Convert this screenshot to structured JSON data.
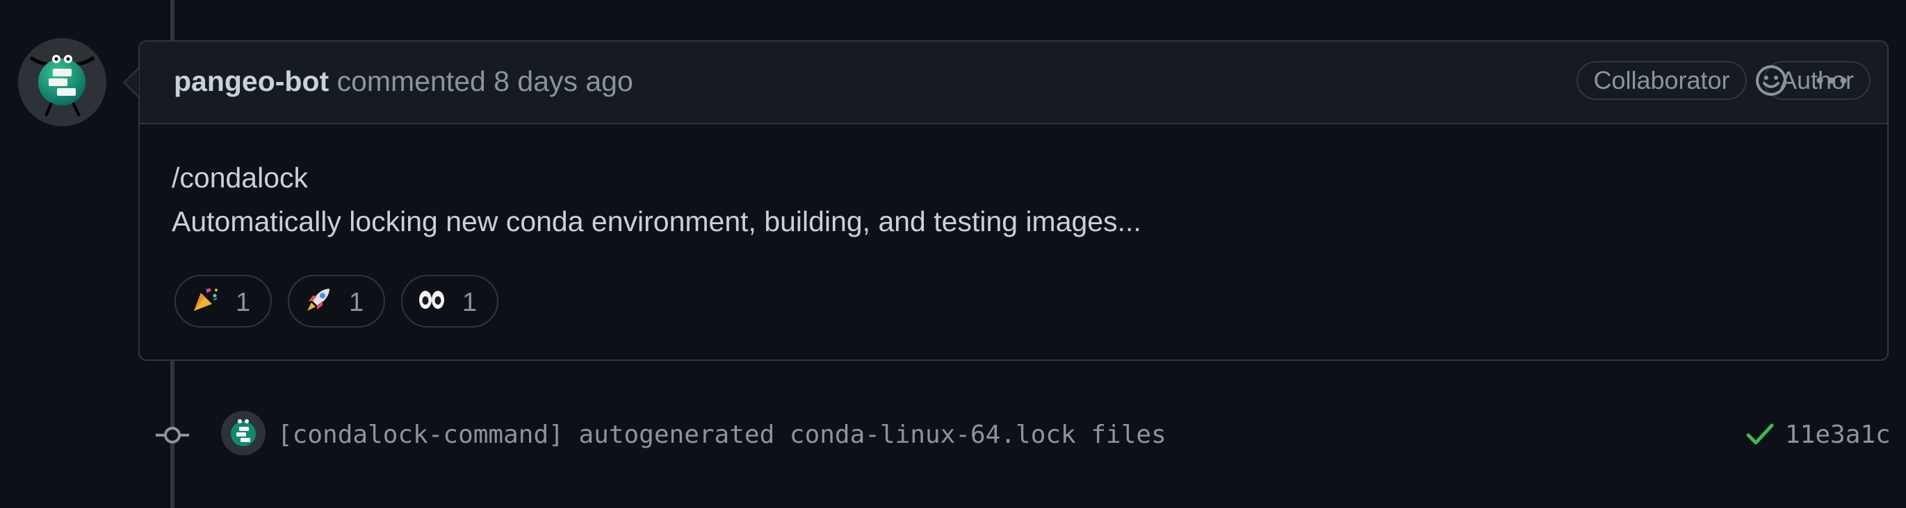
{
  "comment": {
    "author": "pangeo-bot",
    "action_text": "commented 8 days ago",
    "badges": [
      "Collaborator",
      "Author"
    ],
    "body_lines": [
      "/condalock",
      "Automatically locking new conda environment, building, and testing images..."
    ],
    "reactions": [
      {
        "emoji": "party-popper-icon",
        "count": "1"
      },
      {
        "emoji": "rocket-icon",
        "count": "1"
      },
      {
        "emoji": "eyes-icon",
        "count": "1"
      }
    ]
  },
  "commit": {
    "message": "[condalock-command] autogenerated conda-linux-64.lock files",
    "status": "success",
    "sha": "11e3a1c"
  },
  "colors": {
    "background": "#0d1117",
    "header_bg": "#161b22",
    "border": "#30363d",
    "text_primary": "#c9d1d9",
    "text_muted": "#8b949e",
    "success": "#3fb950"
  }
}
